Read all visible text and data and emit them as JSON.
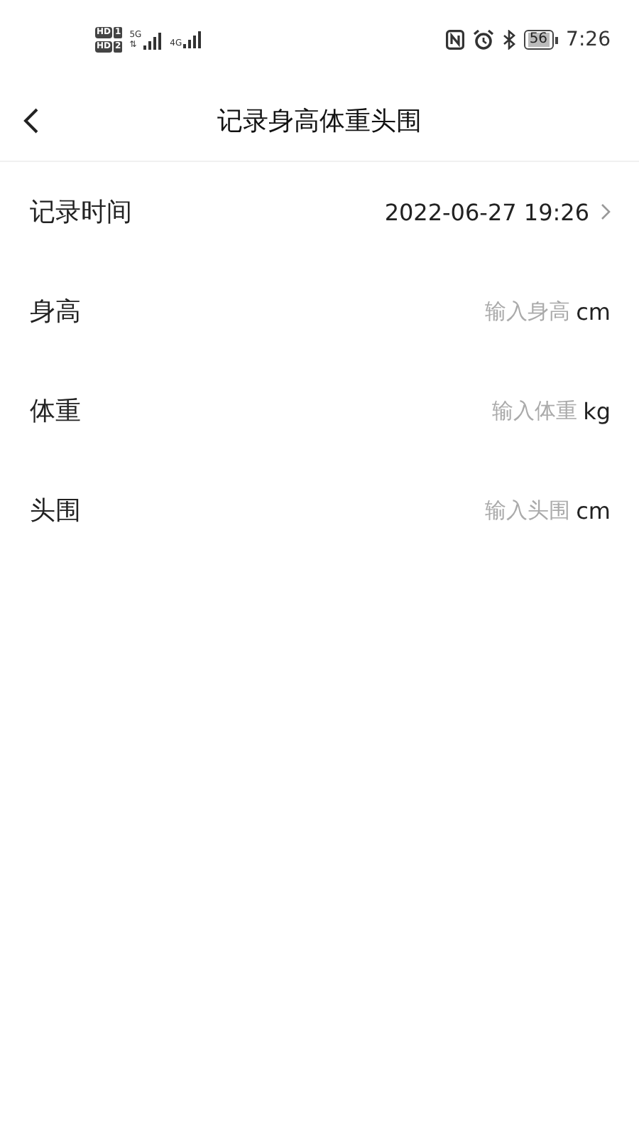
{
  "status_bar": {
    "sims": [
      {
        "badge": "HD",
        "slot": "1"
      },
      {
        "badge": "HD",
        "slot": "2"
      }
    ],
    "networks": [
      {
        "label": "5G",
        "sub": "⇅"
      },
      {
        "label": "4G"
      }
    ],
    "battery": "56",
    "time": "7:26"
  },
  "nav": {
    "title": "记录身高体重头围"
  },
  "rows": [
    {
      "kind": "picker",
      "label": "记录时间",
      "value": "2022-06-27 19:26"
    },
    {
      "kind": "input",
      "label": "身高",
      "placeholder": "输入身高",
      "unit": "cm"
    },
    {
      "kind": "input",
      "label": "体重",
      "placeholder": "输入体重",
      "unit": "kg"
    },
    {
      "kind": "input",
      "label": "头围",
      "placeholder": "输入头围",
      "unit": "cm"
    }
  ]
}
